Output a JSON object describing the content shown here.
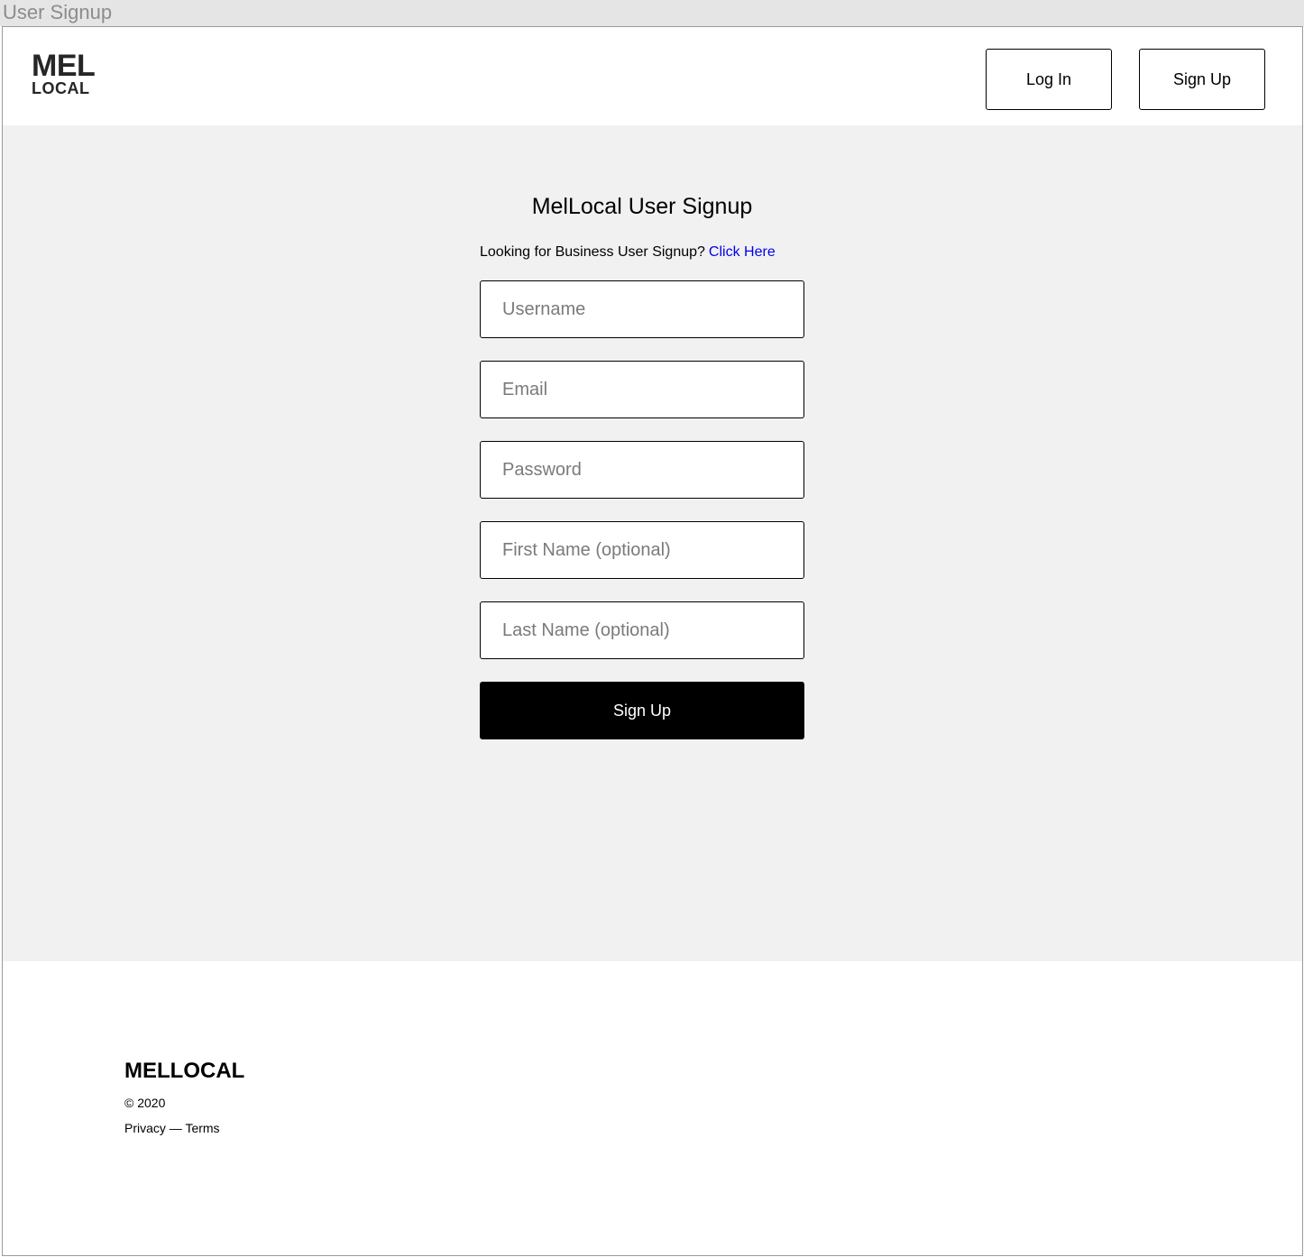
{
  "window": {
    "title": "User Signup"
  },
  "header": {
    "logo": {
      "line1": "MEL",
      "line2": "LOCAL"
    },
    "login_label": "Log In",
    "signup_label": "Sign Up"
  },
  "main": {
    "title": "MelLocal User Signup",
    "business_prompt": "Looking for Business User Signup?",
    "business_link": "Click Here",
    "fields": [
      {
        "placeholder": "Username",
        "value": ""
      },
      {
        "placeholder": "Email",
        "value": ""
      },
      {
        "placeholder": "Password",
        "value": ""
      },
      {
        "placeholder": "First Name (optional)",
        "value": ""
      },
      {
        "placeholder": "Last Name (optional)",
        "value": ""
      }
    ],
    "submit_label": "Sign Up"
  },
  "footer": {
    "brand": "MELLOCAL",
    "copyright": "© 2020",
    "privacy": "Privacy",
    "separator": " — ",
    "terms": "Terms"
  },
  "colors": {
    "page_bg": "#f1f1f1",
    "link": "#0000ee",
    "pin_red": "#e8403a",
    "button_dark": "#000000"
  }
}
